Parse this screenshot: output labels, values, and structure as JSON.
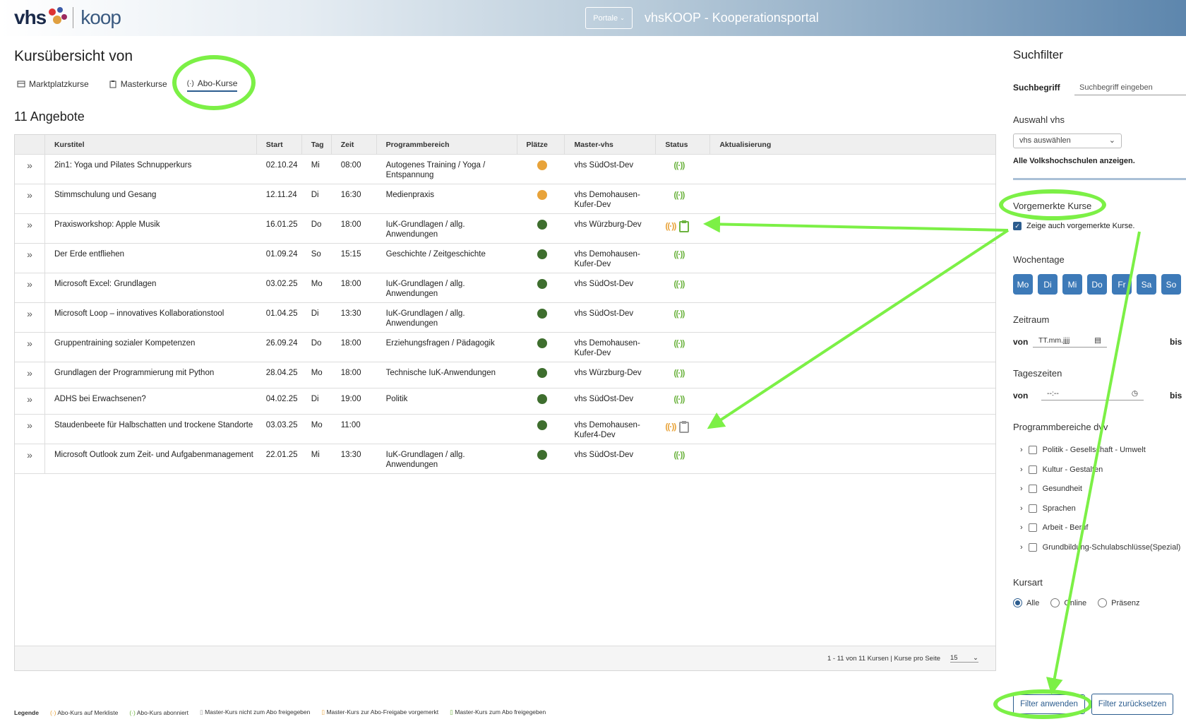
{
  "header": {
    "logo_text": "vhs",
    "logo_koop": "koop",
    "portale_label": "Portale",
    "portal_title": "vhsKOOP - Kooperationsportal"
  },
  "page": {
    "title": "Kursübersicht von",
    "count_label": "11 Angebote"
  },
  "tabs": [
    {
      "label": "Marktplatzkurse",
      "icon": "marketplace-icon"
    },
    {
      "label": "Masterkurse",
      "icon": "clipboard-icon"
    },
    {
      "label": "Abo-Kurse",
      "icon": "broadcast-icon",
      "active": true
    }
  ],
  "table": {
    "columns": [
      "Kurstitel",
      "Start",
      "Tag",
      "Zeit",
      "Programmbereich",
      "Plätze",
      "Master-vhs",
      "Status",
      "Aktualisierung"
    ],
    "rows": [
      {
        "title": "2in1: Yoga und Pilates Schnupperkurs",
        "start": "02.10.24",
        "tag": "Mi",
        "zeit": "08:00",
        "bereich": "Autogenes Training / Yoga / Entspannung",
        "plaetze": "orange",
        "master": "vhs SüdOst-Dev",
        "status": "subscribed"
      },
      {
        "title": "Stimmschulung und Gesang",
        "start": "12.11.24",
        "tag": "Di",
        "zeit": "16:30",
        "bereich": "Medienpraxis",
        "plaetze": "orange",
        "master": "vhs Demohausen-Kufer-Dev",
        "status": "subscribed"
      },
      {
        "title": "Praxisworkshop: Apple Musik",
        "start": "16.01.25",
        "tag": "Do",
        "zeit": "18:00",
        "bereich": "IuK-Grundlagen / allg. Anwendungen",
        "plaetze": "green",
        "master": "vhs Würzburg-Dev",
        "status": "watch-released"
      },
      {
        "title": "Der Erde entfliehen",
        "start": "01.09.24",
        "tag": "So",
        "zeit": "15:15",
        "bereich": "Geschichte / Zeitgeschichte",
        "plaetze": "green",
        "master": "vhs Demohausen-Kufer-Dev",
        "status": "subscribed"
      },
      {
        "title": "Microsoft Excel: Grundlagen",
        "start": "03.02.25",
        "tag": "Mo",
        "zeit": "18:00",
        "bereich": "IuK-Grundlagen / allg. Anwendungen",
        "plaetze": "green",
        "master": "vhs SüdOst-Dev",
        "status": "subscribed"
      },
      {
        "title": "Microsoft Loop – innovatives Kollaborationstool",
        "start": "01.04.25",
        "tag": "Di",
        "zeit": "13:30",
        "bereich": "IuK-Grundlagen / allg. Anwendungen",
        "plaetze": "green",
        "master": "vhs SüdOst-Dev",
        "status": "subscribed"
      },
      {
        "title": "Gruppentraining sozialer Kompetenzen",
        "start": "26.09.24",
        "tag": "Do",
        "zeit": "18:00",
        "bereich": "Erziehungsfragen / Pädagogik",
        "plaetze": "green",
        "master": "vhs Demohausen-Kufer-Dev",
        "status": "subscribed"
      },
      {
        "title": "Grundlagen der Programmierung mit Python",
        "start": "28.04.25",
        "tag": "Mo",
        "zeit": "18:00",
        "bereich": "Technische IuK-Anwendungen",
        "plaetze": "green",
        "master": "vhs Würzburg-Dev",
        "status": "subscribed"
      },
      {
        "title": "ADHS bei Erwachsenen?",
        "start": "04.02.25",
        "tag": "Di",
        "zeit": "19:00",
        "bereich": "Politik",
        "plaetze": "green",
        "master": "vhs SüdOst-Dev",
        "status": "subscribed"
      },
      {
        "title": "Staudenbeete für Halbschatten und trockene Standorte",
        "start": "03.03.25",
        "tag": "Mo",
        "zeit": "11:00",
        "bereich": "",
        "plaetze": "green",
        "master": "vhs Demohausen-Kufer4-Dev",
        "status": "watch-notreleased"
      },
      {
        "title": "Microsoft Outlook zum Zeit- und Aufgabenmanagement",
        "start": "22.01.25",
        "tag": "Mi",
        "zeit": "13:30",
        "bereich": "IuK-Grundlagen / allg. Anwendungen",
        "plaetze": "green",
        "master": "vhs SüdOst-Dev",
        "status": "subscribed"
      }
    ],
    "pagination": "1 - 11 von 11 Kursen | Kurse pro Seite",
    "per_page": "15"
  },
  "legend": {
    "title": "Legende",
    "items": [
      "Abo-Kurs auf Merkliste",
      "Abo-Kurs abonniert",
      "Master-Kurs nicht zum Abo freigegeben",
      "Master-Kurs zur Abo-Freigabe vorgemerkt",
      "Master-Kurs zum Abo freigegeben"
    ]
  },
  "filter": {
    "title": "Suchfilter",
    "search_label": "Suchbegriff",
    "search_placeholder": "Suchbegriff eingeben",
    "vhs_label": "Auswahl vhs",
    "vhs_select": "vhs auswählen",
    "vhs_all": "Alle Volkshochschulen anzeigen.",
    "marked_label": "Vorgemerkte Kurse",
    "marked_checkbox": "Zeige auch vorgemerkte Kurse.",
    "weekdays_label": "Wochentage",
    "weekdays": [
      "Mo",
      "Di",
      "Mi",
      "Do",
      "Fr",
      "Sa",
      "So"
    ],
    "zeitraum_label": "Zeitraum",
    "von": "von",
    "bis": "bis",
    "date_placeholder": "TT.mm.jjjj",
    "tageszeiten_label": "Tageszeiten",
    "time_placeholder": "--:--",
    "programm_label": "Programmbereiche dvv",
    "programme": [
      "Politik - Gesellschaft - Umwelt",
      "Kultur - Gestalten",
      "Gesundheit",
      "Sprachen",
      "Arbeit - Beruf",
      "Grundbildung-Schulabschlüsse(Spezial)"
    ],
    "kursart_label": "Kursart",
    "kursart": [
      "Alle",
      "Online",
      "Präsenz"
    ],
    "apply": "Filter anwenden",
    "reset": "Filter zurücksetzen"
  },
  "colors": {
    "accent": "#2c5d8f",
    "annotation": "#7cf046",
    "green": "#3e6e2e",
    "orange": "#e8a33a",
    "status_green": "#6cb33f"
  }
}
